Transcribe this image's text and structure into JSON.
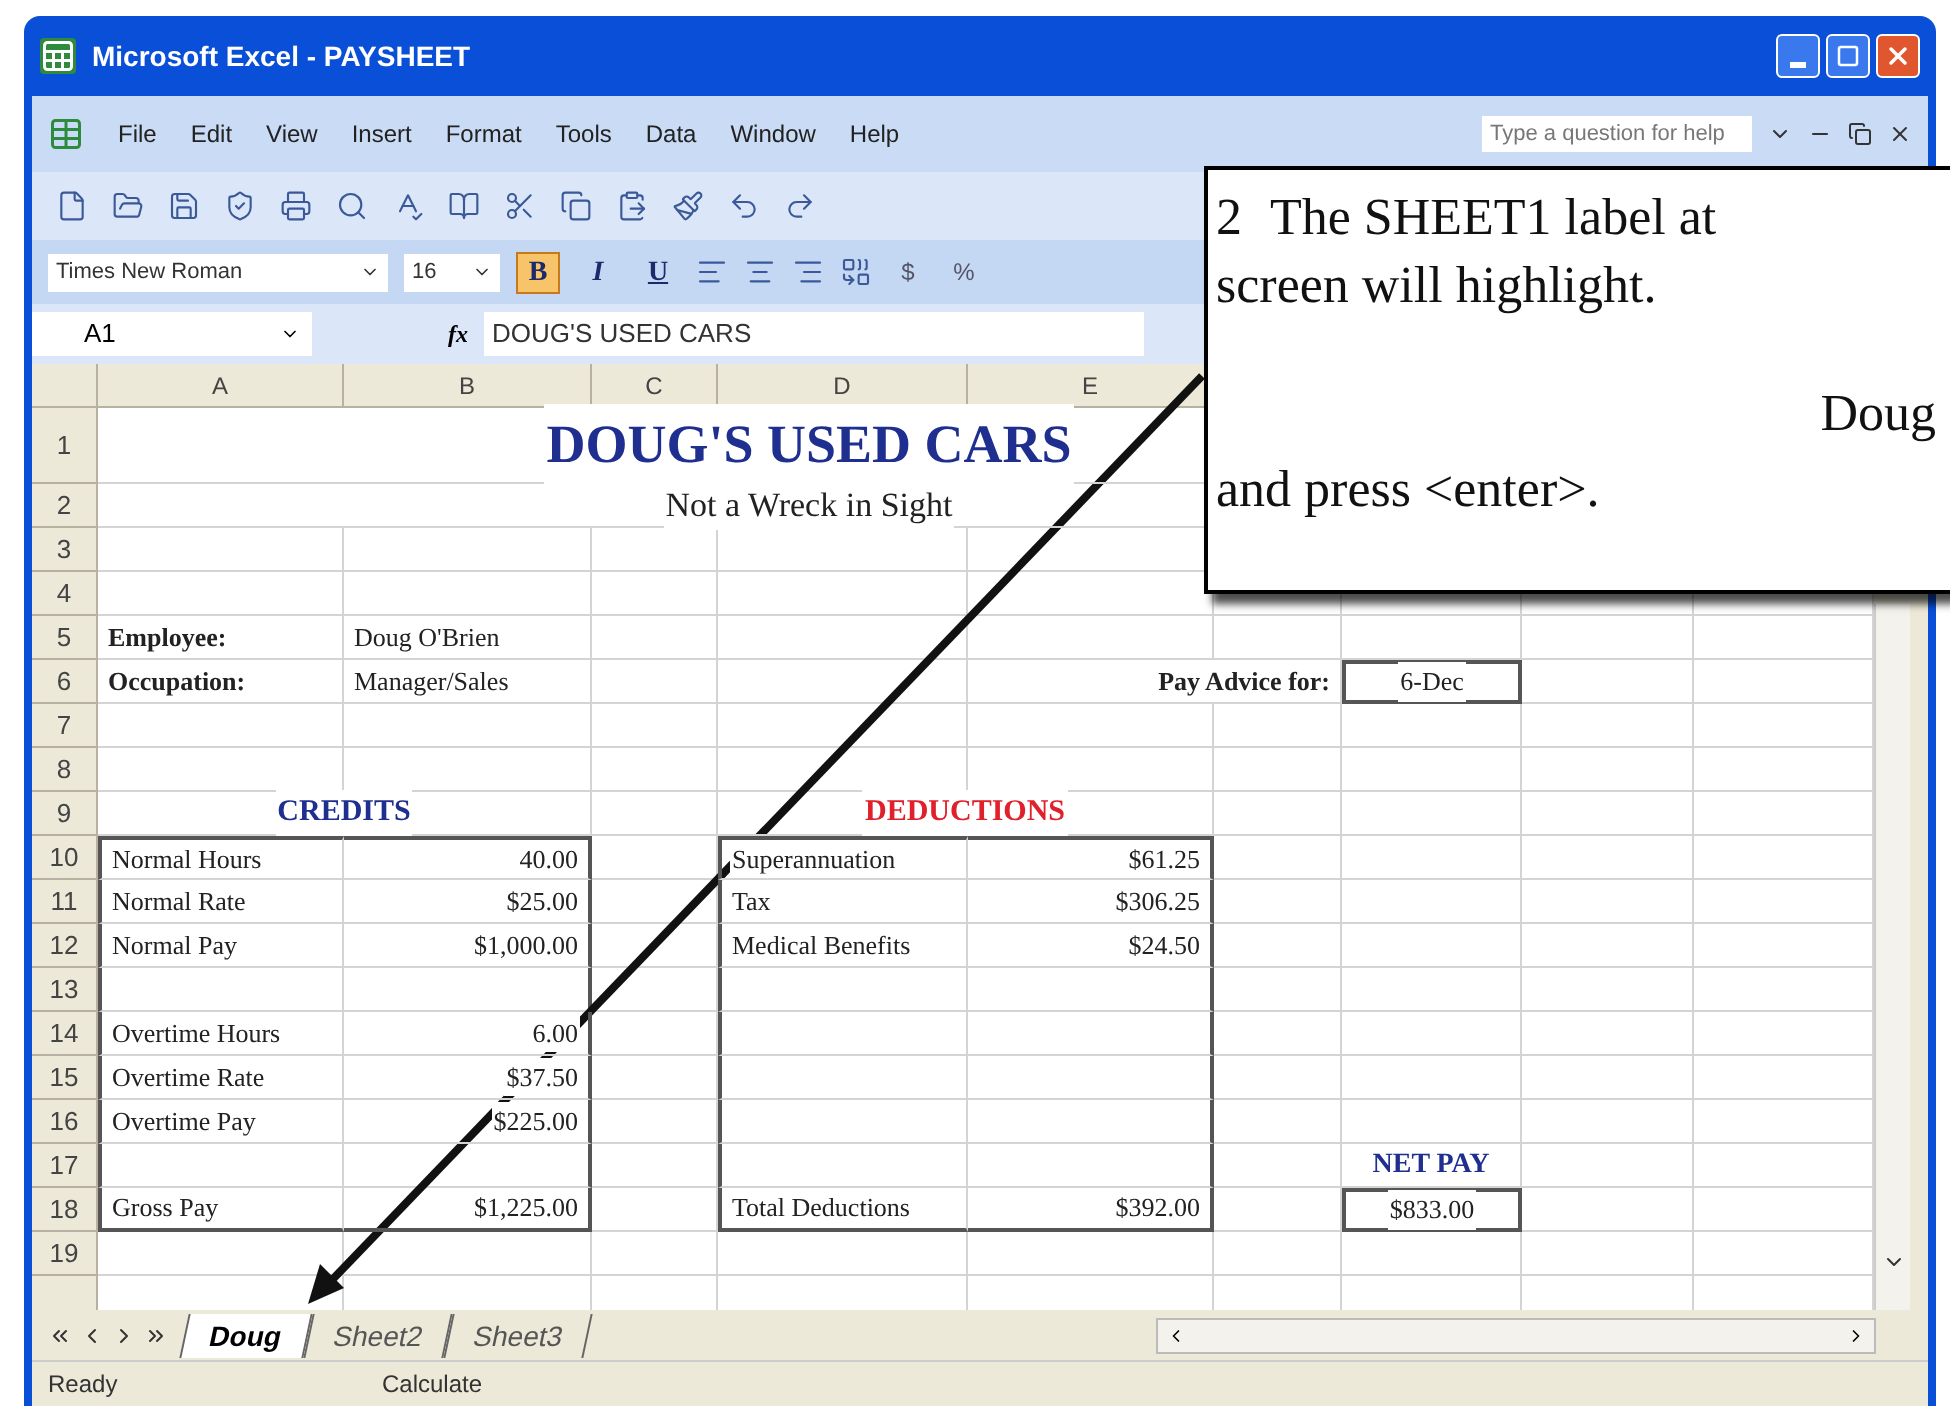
{
  "window": {
    "title": "Microsoft Excel - PAYSHEET"
  },
  "menu": [
    "File",
    "Edit",
    "View",
    "Insert",
    "Format",
    "Tools",
    "Data",
    "Window",
    "Help"
  ],
  "help_box": {
    "placeholder": "Type a question for help"
  },
  "formatting": {
    "font": "Times New Roman",
    "size": "16",
    "style_buttons": [
      {
        "label": "B",
        "selected": true
      },
      {
        "label": "I",
        "selected": false
      },
      {
        "label": "U",
        "selected": false
      }
    ],
    "number_buttons": [
      "$",
      "%"
    ]
  },
  "formula_bar": {
    "name_box": "A1",
    "function_label": "fx",
    "formula": "DOUG'S USED CARS"
  },
  "columns": [
    "A",
    "B",
    "C",
    "D",
    "E"
  ],
  "rows": [
    {
      "header": "1",
      "cells": [
        {
          "kind": "title",
          "text": "DOUG'S USED CARS",
          "color": "#1f2f8f"
        },
        null,
        null,
        null,
        null,
        null,
        null,
        null,
        null
      ]
    },
    {
      "header": "2",
      "cells": [
        {
          "kind": "subtitle",
          "text": "Not a Wreck in Sight"
        },
        null,
        null,
        null,
        null,
        null,
        null,
        null,
        null
      ]
    },
    {
      "header": "3",
      "cells": [
        null,
        null,
        null,
        null,
        null,
        null,
        null,
        null,
        null
      ]
    },
    {
      "header": "4",
      "cells": [
        null,
        null,
        null,
        null,
        null,
        null,
        null,
        null,
        null
      ]
    },
    {
      "header": "5",
      "cells": [
        {
          "kind": "label",
          "text": "Employee:"
        },
        {
          "kind": "text",
          "text": "Doug O'Brien"
        },
        null,
        null,
        null,
        null,
        null,
        null,
        null
      ]
    },
    {
      "header": "6",
      "cells": [
        {
          "kind": "label",
          "text": "Occupation:"
        },
        {
          "kind": "text",
          "text": "Manager/Sales"
        },
        null,
        null,
        null,
        {
          "kind": "label_right",
          "text": "Pay Advice for:"
        },
        {
          "kind": "center",
          "text": "6-Dec"
        },
        null,
        null
      ]
    },
    {
      "header": "7",
      "cells": [
        null,
        null,
        null,
        null,
        null,
        null,
        null,
        null,
        null
      ]
    },
    {
      "header": "8",
      "cells": [
        null,
        null,
        null,
        null,
        null,
        null,
        null,
        null,
        null
      ]
    },
    {
      "header": "9",
      "cells": [
        {
          "kind": "heading",
          "text": "CREDITS",
          "color": "#1f2f8f"
        },
        null,
        null,
        {
          "kind": "heading",
          "text": "DEDUCTIONS",
          "color": "#e0202a"
        },
        null,
        null,
        null,
        null,
        null
      ]
    },
    {
      "header": "10",
      "cells": [
        {
          "kind": "text",
          "text": "Normal Hours"
        },
        {
          "kind": "number",
          "text": "40.00"
        },
        null,
        {
          "kind": "text",
          "text": "Superannuation"
        },
        {
          "kind": "number",
          "text": "$61.25"
        },
        null,
        null,
        null,
        null
      ]
    },
    {
      "header": "11",
      "cells": [
        {
          "kind": "text",
          "text": "Normal Rate"
        },
        {
          "kind": "number",
          "text": "$25.00"
        },
        null,
        {
          "kind": "text",
          "text": "Tax"
        },
        {
          "kind": "number",
          "text": "$306.25"
        },
        null,
        null,
        null,
        null
      ]
    },
    {
      "header": "12",
      "cells": [
        {
          "kind": "text",
          "text": "Normal Pay"
        },
        {
          "kind": "number",
          "text": "$1,000.00"
        },
        null,
        {
          "kind": "text",
          "text": "Medical Benefits"
        },
        {
          "kind": "number",
          "text": "$24.50"
        },
        null,
        null,
        null,
        null
      ]
    },
    {
      "header": "13",
      "cells": [
        null,
        null,
        null,
        null,
        null,
        null,
        null,
        null,
        null
      ]
    },
    {
      "header": "14",
      "cells": [
        {
          "kind": "text",
          "text": "Overtime Hours"
        },
        {
          "kind": "number",
          "text": "6.00"
        },
        null,
        null,
        null,
        null,
        null,
        null,
        null
      ]
    },
    {
      "header": "15",
      "cells": [
        {
          "kind": "text",
          "text": "Overtime Rate"
        },
        {
          "kind": "number",
          "text": "$37.50"
        },
        null,
        null,
        null,
        null,
        null,
        null,
        null
      ]
    },
    {
      "header": "16",
      "cells": [
        {
          "kind": "text",
          "text": "Overtime Pay"
        },
        {
          "kind": "number",
          "text": "$225.00"
        },
        null,
        null,
        null,
        null,
        null,
        null,
        null
      ]
    },
    {
      "header": "17",
      "cells": [
        null,
        null,
        null,
        null,
        null,
        null,
        {
          "kind": "caption",
          "text": "NET PAY",
          "color": "#1f2f8f"
        },
        null,
        null
      ]
    },
    {
      "header": "18",
      "cells": [
        {
          "kind": "text",
          "text": "Gross Pay"
        },
        {
          "kind": "number",
          "text": "$1,225.00"
        },
        null,
        {
          "kind": "text",
          "text": "Total Deductions"
        },
        {
          "kind": "number",
          "text": "$392.00"
        },
        null,
        {
          "kind": "center",
          "text": "$833.00"
        },
        null,
        null
      ]
    },
    {
      "header": "19",
      "cells": [
        null,
        null,
        null,
        null,
        null,
        null,
        null,
        null,
        null
      ]
    }
  ],
  "sheet_tabs": [
    {
      "label": "Doug",
      "selected": true
    },
    {
      "label": "Sheet2",
      "selected": false
    },
    {
      "label": "Sheet3",
      "selected": false
    }
  ],
  "status_bar": {
    "left": "Ready",
    "middle": "Calculate"
  },
  "callout": {
    "step": "2",
    "lines": [
      {
        "kind": "first",
        "text": "The SHEET1 label at"
      },
      {
        "kind": "text",
        "text": "screen will highlight."
      },
      {
        "kind": "tail",
        "text": "Doug"
      },
      {
        "kind": "text",
        "text": "and press <enter>."
      }
    ]
  }
}
